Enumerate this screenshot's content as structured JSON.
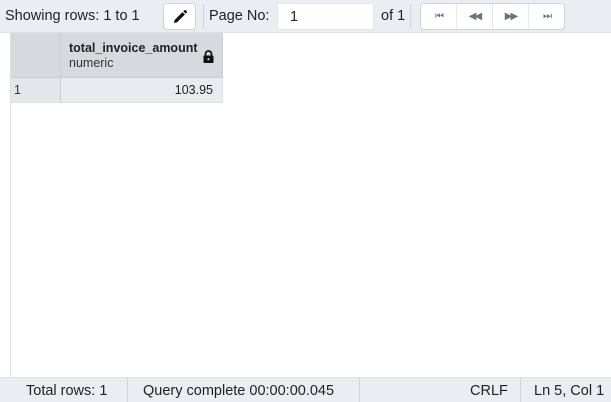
{
  "toolbar": {
    "showing_rows": "Showing rows: 1 to 1",
    "page_label": "Page No:",
    "page_value": "1",
    "of_pages": "of 1",
    "nav_first": "⏮",
    "nav_prev": "◀◀",
    "nav_next": "▶▶",
    "nav_last": "⏭",
    "edit_icon": "pencil-icon"
  },
  "grid": {
    "columns": [
      {
        "name": "total_invoice_amount",
        "type": "numeric",
        "icon": "lock-icon"
      }
    ],
    "rows": [
      {
        "row_number": "1",
        "cells": [
          "103.95"
        ]
      }
    ]
  },
  "status": {
    "total_rows": "Total rows: 1",
    "query_status": "Query complete 00:00:00.045",
    "line_ending": "CRLF",
    "cursor_position": "Ln 5, Col 1"
  }
}
